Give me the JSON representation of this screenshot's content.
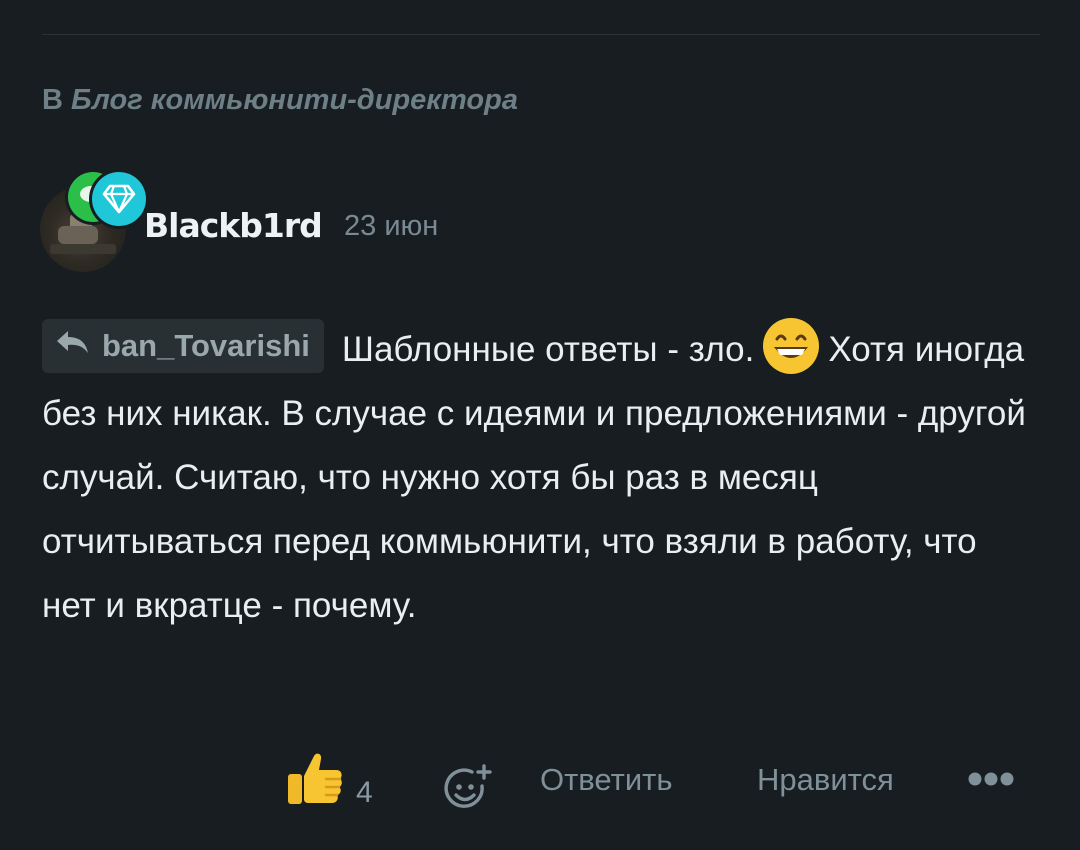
{
  "blog": {
    "prefix": "В",
    "name": "Блог коммьюнити-директора"
  },
  "author": {
    "username": "Blackb1rd",
    "date": "23 июн"
  },
  "comment": {
    "reply_to": "ban_Tovarishi",
    "text_part1": "Шаблонные ответы - зло.",
    "emoji": "grinning-face-with-smiling-eyes",
    "text_part2": "Хотя иногда без них никак. В случае с идеями и предложениями - другой случай. Считаю, что нужно хотя бы раз в месяц отчитываться перед коммьюнити, что взяли в работу, что нет и вкратце - почему."
  },
  "actions": {
    "like_count": "4",
    "reply_label": "Ответить",
    "like_label": "Нравится"
  },
  "colors": {
    "background": "#171d20",
    "accent_green": "#2bbf4a",
    "accent_cyan": "#1fc7d8",
    "muted_text": "#7f9098"
  }
}
